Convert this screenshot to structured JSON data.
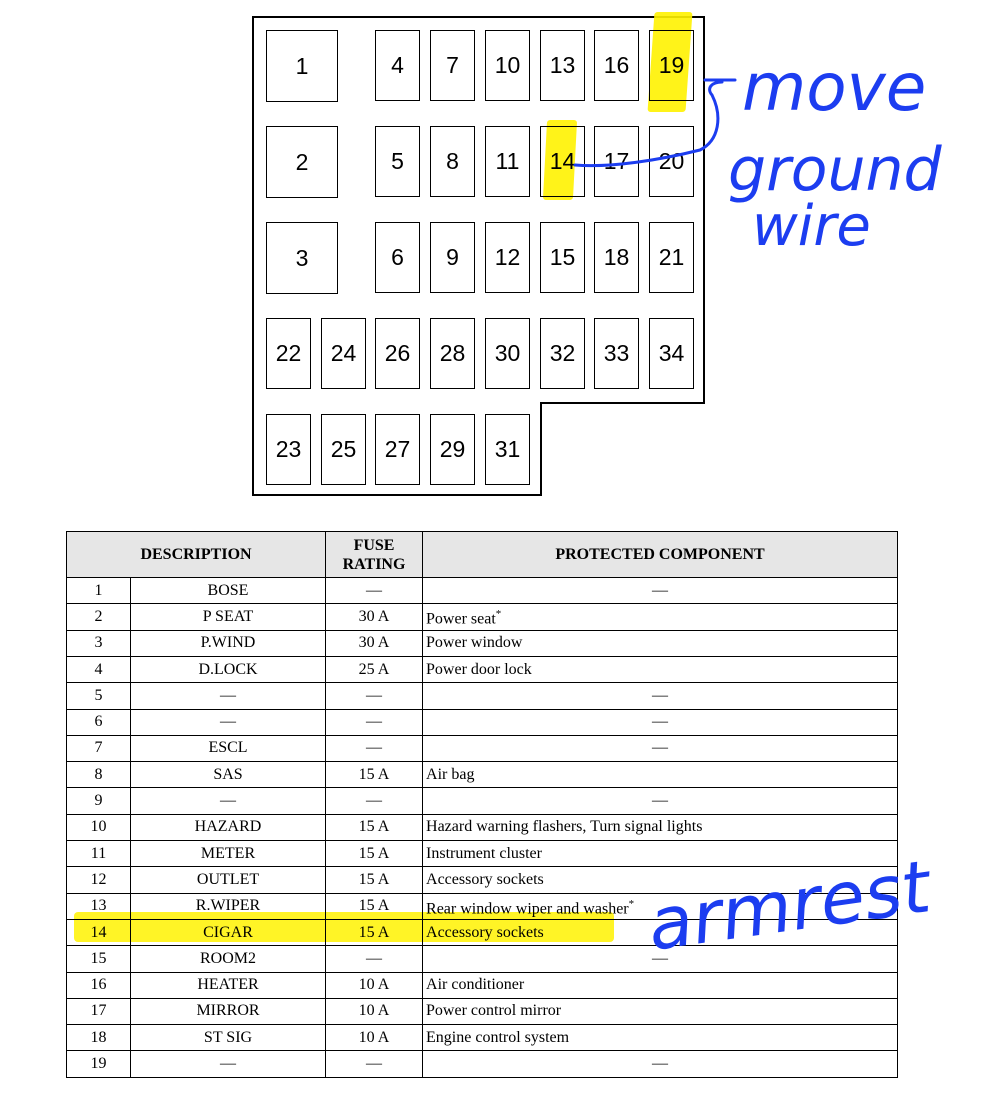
{
  "fuse_box": {
    "fuses": [
      "1",
      "2",
      "3",
      "4",
      "5",
      "6",
      "7",
      "8",
      "9",
      "10",
      "11",
      "12",
      "13",
      "14",
      "15",
      "16",
      "17",
      "18",
      "19",
      "20",
      "21",
      "22",
      "23",
      "24",
      "25",
      "26",
      "27",
      "28",
      "29",
      "30",
      "31",
      "32",
      "33",
      "34"
    ],
    "highlighted": [
      "14",
      "19"
    ],
    "highlight_color": "#fff200"
  },
  "annotations": {
    "note_move": "move",
    "note_ground": "ground",
    "note_wire": "wire",
    "note_armrest": "armrest",
    "ink_color": "#1c3df0"
  },
  "table": {
    "headers": {
      "description": "DESCRIPTION",
      "rating_line1": "FUSE",
      "rating_line2": "RATING",
      "component": "PROTECTED COMPONENT"
    },
    "rows": [
      {
        "no": "1",
        "desc": "BOSE",
        "rating": "—",
        "component": "—"
      },
      {
        "no": "2",
        "desc": "P SEAT",
        "rating": "30 A",
        "component": "Power seat",
        "star": "*"
      },
      {
        "no": "3",
        "desc": "P.WIND",
        "rating": "30 A",
        "component": "Power window"
      },
      {
        "no": "4",
        "desc": "D.LOCK",
        "rating": "25 A",
        "component": "Power door lock"
      },
      {
        "no": "5",
        "desc": "—",
        "rating": "—",
        "component": "—"
      },
      {
        "no": "6",
        "desc": "—",
        "rating": "—",
        "component": "—"
      },
      {
        "no": "7",
        "desc": "ESCL",
        "rating": "—",
        "component": "—"
      },
      {
        "no": "8",
        "desc": "SAS",
        "rating": "15 A",
        "component": "Air bag"
      },
      {
        "no": "9",
        "desc": "—",
        "rating": "—",
        "component": "—"
      },
      {
        "no": "10",
        "desc": "HAZARD",
        "rating": "15 A",
        "component": "Hazard warning flashers, Turn signal lights"
      },
      {
        "no": "11",
        "desc": "METER",
        "rating": "15 A",
        "component": "Instrument cluster"
      },
      {
        "no": "12",
        "desc": "OUTLET",
        "rating": "15 A",
        "component": "Accessory sockets"
      },
      {
        "no": "13",
        "desc": "R.WIPER",
        "rating": "15 A",
        "component": "Rear window wiper and washer",
        "star": "*"
      },
      {
        "no": "14",
        "desc": "CIGAR",
        "rating": "15 A",
        "component": "Accessory sockets",
        "highlight": true
      },
      {
        "no": "15",
        "desc": "ROOM2",
        "rating": "—",
        "component": "—"
      },
      {
        "no": "16",
        "desc": "HEATER",
        "rating": "10 A",
        "component": "Air conditioner"
      },
      {
        "no": "17",
        "desc": "MIRROR",
        "rating": "10 A",
        "component": "Power control mirror"
      },
      {
        "no": "18",
        "desc": "ST SIG",
        "rating": "10 A",
        "component": "Engine control system"
      },
      {
        "no": "19",
        "desc": "—",
        "rating": "—",
        "component": "—"
      }
    ]
  }
}
